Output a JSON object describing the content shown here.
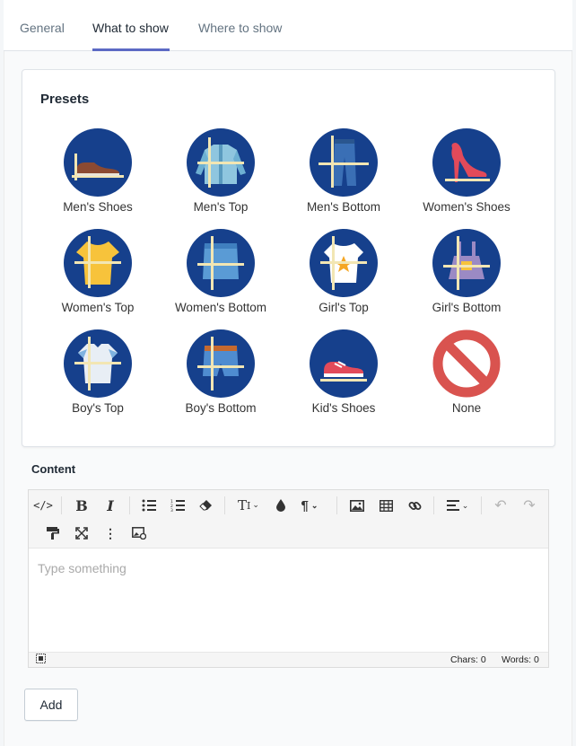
{
  "tabs": [
    "General",
    "What to show",
    "Where to show"
  ],
  "presets": {
    "title": "Presets",
    "items": [
      "Men's Shoes",
      "Men's Top",
      "Men's Bottom",
      "Women's Shoes",
      "Women's Top",
      "Women's Bottom",
      "Girl's Top",
      "Girl's Bottom",
      "Boy's Top",
      "Boy's Bottom",
      "Kid's Shoes",
      "None"
    ]
  },
  "content": {
    "label": "Content",
    "placeholder": "Type something",
    "chars": "Chars: 0",
    "words": "Words: 0"
  },
  "add_label": "Add",
  "colors": {
    "accent": "#5c6ac4",
    "preset_bg": "#16408c",
    "none_red": "#d9534f"
  }
}
